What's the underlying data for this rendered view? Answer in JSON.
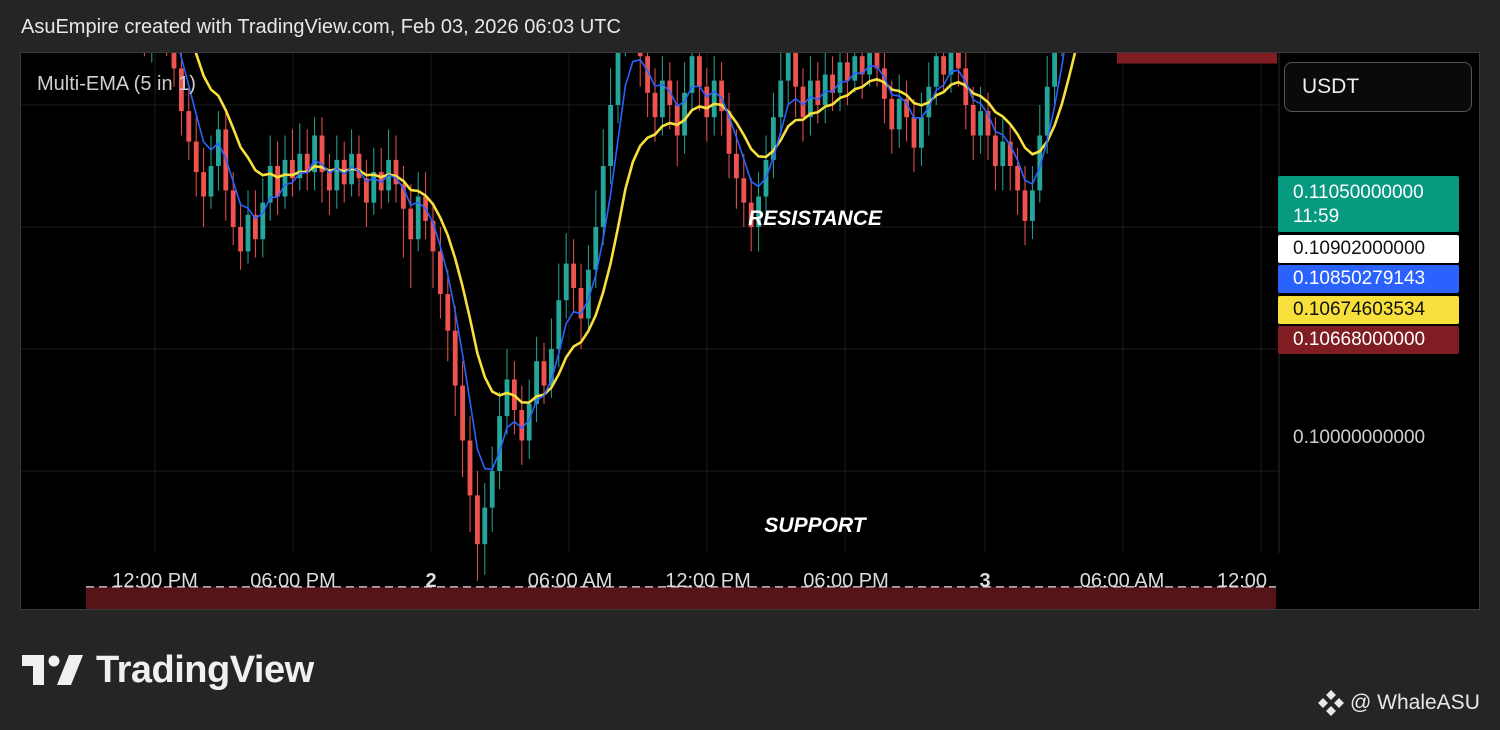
{
  "header": {
    "text": "AsuEmpire created with TradingView.com, Feb 03, 2026 06:03 UTC"
  },
  "indicator": {
    "label": "Multi-EMA (5 in 1)"
  },
  "currency": {
    "label": "USDT"
  },
  "price_tags": {
    "last_price": "0.11050000000",
    "countdown": "11:59",
    "entry": "0.10902000000",
    "ema_blue": "0.10850279143",
    "ema_yellow": "0.10674603534",
    "stop": "0.10668000000"
  },
  "price_axis": {
    "tick_1": "0.10000000000"
  },
  "time_axis": {
    "labels": [
      "12:00 PM",
      "06:00 PM",
      "2",
      "06:00 AM",
      "12:00 PM",
      "06:00 PM",
      "3",
      "06:00 AM",
      "12:00"
    ]
  },
  "zones": {
    "resistance": "RESISTANCE",
    "support": "SUPPORT"
  },
  "brand": {
    "name": "TradingView",
    "icon": "tradingview-logo-icon"
  },
  "watermark": {
    "text": "@ WhaleASU",
    "icon": "binance-diamond-icon"
  },
  "colors": {
    "background": "#000000",
    "up": "#26a69a",
    "down": "#ef5350",
    "ema_blue": "#2962ff",
    "ema_yellow": "#f7e03b",
    "zone": "#5a1519",
    "target": "#1d5c23",
    "stop": "#7f1d22",
    "last": "#089981"
  },
  "chart_data": {
    "type": "candlestick",
    "symbol_quote": "USDT",
    "x_ticks": [
      "12:00 PM",
      "06:00 PM",
      "2",
      "06:00 AM",
      "12:00 PM",
      "06:00 PM",
      "3",
      "06:00 AM",
      "12:00"
    ],
    "y_ticks": [
      0.1
    ],
    "y_range": [
      0.0965,
      0.1135
    ],
    "interval": "15m",
    "candles": [
      [
        0.11,
        0.1095,
        0.1104,
        0.1091
      ],
      [
        0.1095,
        0.1092,
        0.1099,
        0.1088
      ],
      [
        0.1092,
        0.1107,
        0.1112,
        0.109
      ],
      [
        0.1107,
        0.1113,
        0.1122,
        0.1104
      ],
      [
        0.1113,
        0.1108,
        0.1118,
        0.1102
      ],
      [
        0.1108,
        0.1117,
        0.1121,
        0.1106
      ],
      [
        0.1117,
        0.1105,
        0.1121,
        0.11
      ],
      [
        0.1105,
        0.1097,
        0.1109,
        0.1094
      ],
      [
        0.1097,
        0.1092,
        0.1101,
        0.1087
      ],
      [
        0.1092,
        0.1085,
        0.1096,
        0.1079
      ],
      [
        0.1085,
        0.1074,
        0.1089,
        0.1071
      ],
      [
        0.1074,
        0.1081,
        0.1086,
        0.1071
      ],
      [
        0.1081,
        0.1086,
        0.109,
        0.1079
      ],
      [
        0.1086,
        0.1079,
        0.1091,
        0.1076
      ],
      [
        0.1079,
        0.1084,
        0.1089,
        0.1077
      ],
      [
        0.1084,
        0.1077,
        0.1088,
        0.1072
      ],
      [
        0.1077,
        0.107,
        0.1081,
        0.1068
      ],
      [
        0.107,
        0.1074,
        0.1079,
        0.1067
      ],
      [
        0.1074,
        0.1079,
        0.1084,
        0.1071
      ],
      [
        0.1079,
        0.1071,
        0.1083,
        0.1068
      ],
      [
        0.1071,
        0.1066,
        0.1075,
        0.1063
      ],
      [
        0.1066,
        0.1059,
        0.1069,
        0.1055
      ],
      [
        0.1059,
        0.1054,
        0.1063,
        0.1051
      ],
      [
        0.1054,
        0.1049,
        0.1058,
        0.1045
      ],
      [
        0.1049,
        0.1045,
        0.1053,
        0.104
      ],
      [
        0.1045,
        0.105,
        0.1055,
        0.1043
      ],
      [
        0.105,
        0.1056,
        0.1059,
        0.1046
      ],
      [
        0.1056,
        0.1046,
        0.1059,
        0.1041
      ],
      [
        0.1046,
        0.104,
        0.1049,
        0.1037
      ],
      [
        0.104,
        0.1036,
        0.1044,
        0.1033
      ],
      [
        0.1036,
        0.1042,
        0.1046,
        0.1034
      ],
      [
        0.1042,
        0.1038,
        0.1046,
        0.1035
      ],
      [
        0.1038,
        0.1044,
        0.1048,
        0.1035
      ],
      [
        0.1044,
        0.105,
        0.1055,
        0.1041
      ],
      [
        0.105,
        0.1045,
        0.1054,
        0.1042
      ],
      [
        0.1045,
        0.1051,
        0.1055,
        0.1043
      ],
      [
        0.1051,
        0.1048,
        0.1056,
        0.1045
      ],
      [
        0.1048,
        0.1052,
        0.1057,
        0.1046
      ],
      [
        0.1052,
        0.1049,
        0.1056,
        0.1046
      ],
      [
        0.1049,
        0.1055,
        0.1058,
        0.1046
      ],
      [
        0.1055,
        0.1049,
        0.1058,
        0.1044
      ],
      [
        0.1049,
        0.1046,
        0.1052,
        0.1042
      ],
      [
        0.1046,
        0.1051,
        0.1055,
        0.1043
      ],
      [
        0.1051,
        0.1047,
        0.1054,
        0.1044
      ],
      [
        0.1047,
        0.1052,
        0.1056,
        0.1045
      ],
      [
        0.1052,
        0.1048,
        0.1055,
        0.1045
      ],
      [
        0.1048,
        0.1044,
        0.1051,
        0.104
      ],
      [
        0.1044,
        0.1049,
        0.1053,
        0.1042
      ],
      [
        0.1049,
        0.1046,
        0.1053,
        0.1043
      ],
      [
        0.1046,
        0.1051,
        0.1056,
        0.1044
      ],
      [
        0.1051,
        0.1047,
        0.1055,
        0.1044
      ],
      [
        0.1047,
        0.1043,
        0.105,
        0.1035
      ],
      [
        0.1043,
        0.1038,
        0.1047,
        0.103
      ],
      [
        0.1038,
        0.1045,
        0.1049,
        0.1036
      ],
      [
        0.1045,
        0.1041,
        0.1049,
        0.1038
      ],
      [
        0.1041,
        0.1036,
        0.1044,
        0.103
      ],
      [
        0.1036,
        0.1029,
        0.104,
        0.1025
      ],
      [
        0.1029,
        0.1023,
        0.1033,
        0.1018
      ],
      [
        0.1023,
        0.1014,
        0.1027,
        0.1009
      ],
      [
        0.1014,
        0.1005,
        0.1018,
        0.0999
      ],
      [
        0.1005,
        0.0996,
        0.1009,
        0.099
      ],
      [
        0.0996,
        0.0988,
        0.1,
        0.0982
      ],
      [
        0.0988,
        0.0994,
        0.0998,
        0.0983
      ],
      [
        0.0994,
        0.1,
        0.1004,
        0.099
      ],
      [
        0.1,
        0.1009,
        0.1013,
        0.0997
      ],
      [
        0.1009,
        0.1015,
        0.102,
        0.1006
      ],
      [
        0.1015,
        0.101,
        0.1018,
        0.1006
      ],
      [
        0.101,
        0.1005,
        0.1014,
        0.1001
      ],
      [
        0.1005,
        0.1011,
        0.1015,
        0.1002
      ],
      [
        0.1011,
        0.1018,
        0.1022,
        0.1008
      ],
      [
        0.1018,
        0.1014,
        0.1021,
        0.1011
      ],
      [
        0.1014,
        0.102,
        0.1025,
        0.1012
      ],
      [
        0.102,
        0.1028,
        0.1034,
        0.1017
      ],
      [
        0.1028,
        0.1034,
        0.1039,
        0.1025
      ],
      [
        0.1034,
        0.103,
        0.1038,
        0.1026
      ],
      [
        0.103,
        0.1025,
        0.1034,
        0.102
      ],
      [
        0.1025,
        0.1033,
        0.1037,
        0.1023
      ],
      [
        0.1033,
        0.104,
        0.1046,
        0.103
      ],
      [
        0.104,
        0.105,
        0.1056,
        0.1037
      ],
      [
        0.105,
        0.106,
        0.1066,
        0.1047
      ],
      [
        0.106,
        0.1072,
        0.1079,
        0.1057
      ],
      [
        0.1072,
        0.1081,
        0.1087,
        0.1068
      ],
      [
        0.1081,
        0.1075,
        0.1085,
        0.107
      ],
      [
        0.1075,
        0.1068,
        0.1079,
        0.1063
      ],
      [
        0.1068,
        0.1062,
        0.1072,
        0.1058
      ],
      [
        0.1062,
        0.1058,
        0.1066,
        0.1054
      ],
      [
        0.1058,
        0.1064,
        0.1068,
        0.1055
      ],
      [
        0.1064,
        0.106,
        0.1067,
        0.1056
      ],
      [
        0.106,
        0.1055,
        0.1064,
        0.105
      ],
      [
        0.1055,
        0.1062,
        0.1067,
        0.1052
      ],
      [
        0.1062,
        0.1068,
        0.1072,
        0.1059
      ],
      [
        0.1068,
        0.1063,
        0.1071,
        0.1059
      ],
      [
        0.1063,
        0.1058,
        0.1066,
        0.1054
      ],
      [
        0.1058,
        0.1064,
        0.1068,
        0.1055
      ],
      [
        0.1064,
        0.1059,
        0.1067,
        0.1055
      ],
      [
        0.1059,
        0.1052,
        0.1062,
        0.1048
      ],
      [
        0.1052,
        0.1048,
        0.1056,
        0.1043
      ],
      [
        0.1048,
        0.1044,
        0.1052,
        0.104
      ],
      [
        0.1044,
        0.104,
        0.1048,
        0.1036
      ],
      [
        0.104,
        0.1045,
        0.1049,
        0.1036
      ],
      [
        0.1045,
        0.1051,
        0.1055,
        0.1042
      ],
      [
        0.1051,
        0.1058,
        0.1062,
        0.1048
      ],
      [
        0.1058,
        0.1064,
        0.107,
        0.1055
      ],
      [
        0.1064,
        0.1069,
        0.1074,
        0.106
      ],
      [
        0.1069,
        0.1063,
        0.1073,
        0.1058
      ],
      [
        0.1063,
        0.1058,
        0.1066,
        0.1054
      ],
      [
        0.1058,
        0.1064,
        0.1068,
        0.1055
      ],
      [
        0.1064,
        0.106,
        0.1067,
        0.1057
      ],
      [
        0.106,
        0.1065,
        0.1069,
        0.1057
      ],
      [
        0.1065,
        0.1062,
        0.1068,
        0.1059
      ],
      [
        0.1062,
        0.1067,
        0.1071,
        0.1059
      ],
      [
        0.1067,
        0.1064,
        0.107,
        0.106
      ],
      [
        0.1064,
        0.1068,
        0.1072,
        0.1062
      ],
      [
        0.1068,
        0.1065,
        0.1071,
        0.1061
      ],
      [
        0.1065,
        0.1069,
        0.1073,
        0.1063
      ],
      [
        0.1069,
        0.1066,
        0.1072,
        0.1063
      ],
      [
        0.1066,
        0.1061,
        0.1069,
        0.1057
      ],
      [
        0.1061,
        0.1056,
        0.1064,
        0.1052
      ],
      [
        0.1056,
        0.1061,
        0.1065,
        0.1053
      ],
      [
        0.1061,
        0.1058,
        0.1064,
        0.1054
      ],
      [
        0.1058,
        0.1053,
        0.1061,
        0.1049
      ],
      [
        0.1053,
        0.1058,
        0.1062,
        0.105
      ],
      [
        0.1058,
        0.1063,
        0.1067,
        0.1055
      ],
      [
        0.1063,
        0.1068,
        0.1072,
        0.106
      ],
      [
        0.1068,
        0.1065,
        0.1071,
        0.1062
      ],
      [
        0.1065,
        0.107,
        0.1073,
        0.1062
      ],
      [
        0.107,
        0.1066,
        0.1072,
        0.1063
      ],
      [
        0.1066,
        0.106,
        0.1069,
        0.1056
      ],
      [
        0.106,
        0.1055,
        0.1063,
        0.1051
      ],
      [
        0.1055,
        0.1059,
        0.1063,
        0.1052
      ],
      [
        0.1059,
        0.1055,
        0.1062,
        0.1051
      ],
      [
        0.1055,
        0.105,
        0.1058,
        0.1046
      ],
      [
        0.105,
        0.1054,
        0.1058,
        0.1046
      ],
      [
        0.1054,
        0.105,
        0.1057,
        0.1046
      ],
      [
        0.105,
        0.1046,
        0.1053,
        0.1042
      ],
      [
        0.1046,
        0.1041,
        0.105,
        0.1037
      ],
      [
        0.1041,
        0.1046,
        0.105,
        0.1038
      ],
      [
        0.1046,
        0.1055,
        0.106,
        0.1044
      ],
      [
        0.1055,
        0.1063,
        0.1068,
        0.1052
      ],
      [
        0.1063,
        0.1071,
        0.1077,
        0.106
      ],
      [
        0.1071,
        0.108,
        0.1086,
        0.1068
      ],
      [
        0.108,
        0.109,
        0.1096,
        0.1077
      ],
      [
        0.109,
        0.1097,
        0.1104,
        0.1087
      ],
      [
        0.1097,
        0.1093,
        0.1114,
        0.109
      ],
      [
        0.1093,
        0.1088,
        0.1098,
        0.1084
      ],
      [
        0.1088,
        0.1094,
        0.1099,
        0.1085
      ],
      [
        0.1094,
        0.1091,
        0.1098,
        0.1086
      ],
      [
        0.1091,
        0.1105,
        0.1108,
        0.1089
      ]
    ],
    "ema_fast_last": 0.10850279143,
    "ema_slow_last": 0.10674603534,
    "last_price": 0.1105,
    "entry_price": 0.10902,
    "stop_price": 0.10668,
    "target_price": 0.1131,
    "zones": [
      {
        "name": "RESISTANCE",
        "low": 0.109,
        "high": 0.11
      },
      {
        "name": "SUPPORT",
        "low": 0.097,
        "high": 0.0981
      },
      {
        "name": "",
        "low": 0.1128,
        "high": 0.1138
      }
    ]
  }
}
